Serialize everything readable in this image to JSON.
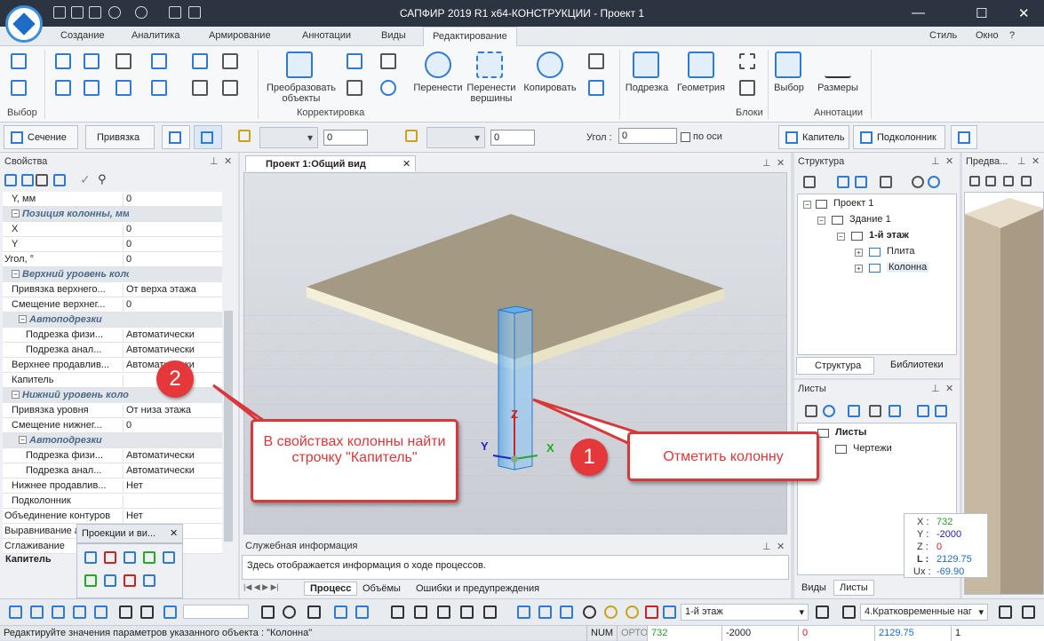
{
  "app": {
    "title": "САПФИР 2019 R1 x64-КОНСТРУКЦИИ - Проект 1",
    "win_min": "—",
    "win_max": "☐",
    "win_close": "✕"
  },
  "tabs": [
    "Создание",
    "Аналитика",
    "Армирование",
    "Аннотации",
    "Виды",
    "Редактирование"
  ],
  "tab_right": {
    "style": "Стиль",
    "window": "Окно",
    "help": "?"
  },
  "ribbon": {
    "groups": [
      "Выбор",
      "Корректировка",
      "Блоки",
      "Аннотации"
    ],
    "buttons": {
      "transform": "Преобразовать объекты",
      "move": "Перенести",
      "move_vertex": "Перенести вершины",
      "copy": "Копировать",
      "podrezka": "Подрезка",
      "geometry": "Геометрия",
      "select": "Выбор",
      "dimensions": "Размеры"
    }
  },
  "toolbar2": {
    "section": "Сечение",
    "snap": "Привязка",
    "val1": "0",
    "val2": "0",
    "angle_label": "Угол :",
    "angle_value": "0",
    "by_axes": "по оси",
    "capital": "Капитель",
    "podkolonnik": "Подколонник"
  },
  "properties": {
    "title": "Свойства",
    "rows": [
      {
        "k": "Y, мм",
        "v": "0",
        "indent": 1,
        "sec": false
      },
      {
        "k": "Позиция колонны, мм",
        "v": "",
        "indent": 1,
        "sec": true
      },
      {
        "k": "X",
        "v": "0",
        "indent": 1,
        "sec": false
      },
      {
        "k": "Y",
        "v": "0",
        "indent": 1,
        "sec": false
      },
      {
        "k": "Угол, °",
        "v": "0",
        "indent": 0,
        "sec": false
      },
      {
        "k": "Верхний уровень колонны",
        "v": "",
        "indent": 1,
        "sec": true
      },
      {
        "k": "Привязка верхнего...",
        "v": "От верха этажа",
        "indent": 1,
        "sec": false
      },
      {
        "k": "Смещение верхнег...",
        "v": "0",
        "indent": 1,
        "sec": false
      },
      {
        "k": "Автоподрезки",
        "v": "",
        "indent": 2,
        "sec": true
      },
      {
        "k": "Подрезка физи...",
        "v": "Автоматически",
        "indent": 3,
        "sec": false
      },
      {
        "k": "Подрезка анал...",
        "v": "Автоматически",
        "indent": 3,
        "sec": false
      },
      {
        "k": "Верхнее продавлив...",
        "v": "Автоматически",
        "indent": 1,
        "sec": false
      },
      {
        "k": "Капитель",
        "v": "",
        "indent": 1,
        "sec": false
      },
      {
        "k": "Нижний уровень колонны",
        "v": "",
        "indent": 1,
        "sec": true
      },
      {
        "k": "Привязка уровня",
        "v": "От низа этажа",
        "indent": 1,
        "sec": false
      },
      {
        "k": "Смещение нижнег...",
        "v": "0",
        "indent": 1,
        "sec": false
      },
      {
        "k": "Автоподрезки",
        "v": "",
        "indent": 2,
        "sec": true
      },
      {
        "k": "Подрезка физи...",
        "v": "Автоматически",
        "indent": 3,
        "sec": false
      },
      {
        "k": "Подрезка анал...",
        "v": "Автоматически",
        "indent": 3,
        "sec": false
      },
      {
        "k": "Нижнее продавлив...",
        "v": "Нет",
        "indent": 1,
        "sec": false
      },
      {
        "k": "Подколонник",
        "v": "",
        "indent": 1,
        "sec": false
      },
      {
        "k": "Объединение контуров",
        "v": "Нет",
        "indent": 0,
        "sec": false
      },
      {
        "k": "Выравнивание а...",
        "v": "",
        "indent": 0,
        "sec": false
      },
      {
        "k": "Сглаживание",
        "v": "",
        "indent": 0,
        "sec": false
      }
    ],
    "footer_label": "Капитель",
    "projections_title": "Проекции и ви..."
  },
  "view": {
    "tab": "Проект 1:Общий вид",
    "axis_x": "X",
    "axis_y": "Y",
    "axis_z": "Z"
  },
  "info": {
    "title": "Служебная информация",
    "text": "Здесь отображается информация о ходе процессов.",
    "tabs": [
      "Процесс",
      "Объёмы",
      "Ошибки и предупреждения"
    ]
  },
  "structure": {
    "title": "Структура",
    "tree": [
      "Проект 1",
      "Здание 1",
      "1-й этаж",
      "Плита",
      "Колонна"
    ],
    "tab_structure": "Структура",
    "tab_libraries": "Библиотеки"
  },
  "sheets": {
    "title": "Листы",
    "tree": [
      "Листы",
      "Чертежи"
    ],
    "tab_views": "Виды",
    "tab_sheets": "Листы"
  },
  "preview": {
    "title": "Предва..."
  },
  "coords": {
    "x_label": "X :",
    "x": "732",
    "y_label": "Y :",
    "y": "-2000",
    "z_label": "Z :",
    "z": "0",
    "l_label": "L :",
    "l": "2129.75",
    "ux_label": "Ux :",
    "ux": "-69.90"
  },
  "bottom": {
    "floor": "1-й этаж",
    "load": "4.Кратковременные наг"
  },
  "status": {
    "text": "Редактируйте значения параметров указанного объекта : \"Колонна\"",
    "num": "NUM",
    "orto": "ОРТО",
    "x": "732",
    "y": "-2000",
    "z": "0",
    "l": "2129.75",
    "n": "1"
  },
  "callouts": {
    "c1_number": "1",
    "c1_text": "Отметить колонну",
    "c2_number": "2",
    "c2_text": "В свойствах колонны найти строчку \"Капитель\""
  },
  "colors": {
    "accent": "#2f7bd1",
    "callout": "#d9383a",
    "titlebar": "#2b3440"
  }
}
